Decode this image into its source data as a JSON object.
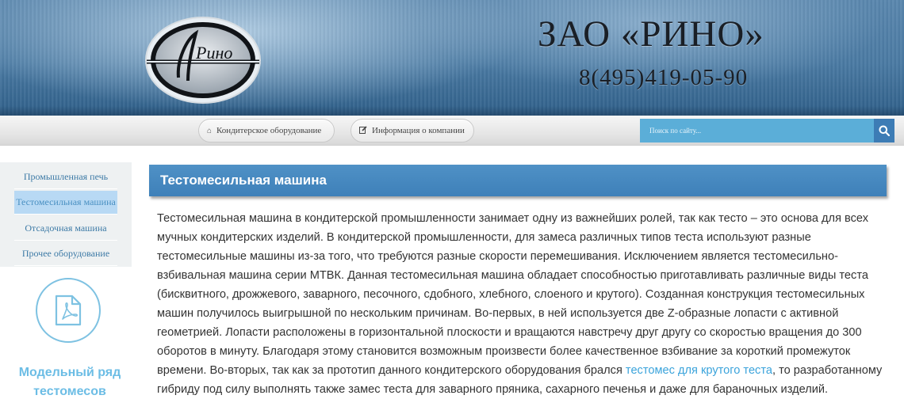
{
  "header": {
    "logo_text": "Рино",
    "company_name": "ЗАО «РИНО»",
    "phone": "8(495)419-05-90"
  },
  "nav": {
    "items": [
      {
        "label": "Кондитерское оборудование",
        "icon": "home-icon"
      },
      {
        "label": "Информация о компании",
        "icon": "edit-icon"
      }
    ],
    "search_placeholder": "Поиск по сайту...",
    "search_icon": "search-icon"
  },
  "sidebar": {
    "items": [
      {
        "label": "Промышленная печь",
        "active": false
      },
      {
        "label": "Тестомесильная машина",
        "active": true
      },
      {
        "label": "Отсадочная машина",
        "active": false
      },
      {
        "label": "Прочее оборудование",
        "active": false
      }
    ],
    "pdf_icon": "pdf-file-icon",
    "model_title": "Модельный ряд тестомесов"
  },
  "main": {
    "title": "Тестомесильная машина",
    "text_before_link": "Тестомесильная машина в кондитерской промышленности занимает одну из важнейших ролей, так как тесто – это основа для всех мучных кондитерских изделий. В кондитерской промышленности, для замеса различных типов теста используют разные тестомесильные машины из-за того, что требуются разные скорости перемешивания. Исключением является тестомесильно-взбивальная машина серии МТВК. Данная тестомесильная машина обладает способностью приготавливать различные виды теста (бисквитного, дрожжевого, заварного, песочного, сдобного, хлебного, слоеного и крутого). Созданная конструкция тестомесильных машин получилось выигрышной по нескольким причинам. Во-первых, в ней используется две Z-образные лопасти с активной геометрией. Лопасти расположены в горизонтальной плоскости и вращаются навстречу друг другу со скоростью вращения до 300 оборотов в минуту. Благодаря этому становится возможным произвести более качественное взбивание за короткий промежуток времени. Во-вторых, так как за прототип данного кондитерского оборудования брался ",
    "link_text": "тестомес для крутого теста",
    "text_after_link": ", то разработанному гибриду под силу выполнять также замес теста для заварного пряника, сахарного печенья и даже для бараночных изделий."
  },
  "colors": {
    "header_blue": "#4a7aa3",
    "accent_blue": "#3e80b9",
    "search_blue": "#5baed8",
    "link_blue": "#3aa3db",
    "sidebar_active": "#b8d9f4"
  }
}
